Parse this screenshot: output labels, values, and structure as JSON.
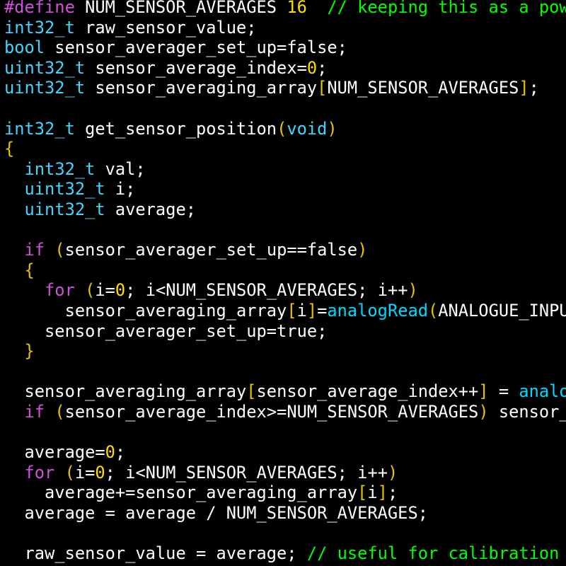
{
  "colors": {
    "background": "#000000",
    "default": "#ffffff",
    "preprocessor": "#d050d8",
    "keyword": "#d050d8",
    "type": "#42d6ff",
    "number": "#ffdd00",
    "comment": "#00ff00",
    "punct": "#e6c300",
    "function": "#00d8ff"
  },
  "lines": [
    [
      [
        "preprocessor",
        "#define"
      ],
      [
        "default",
        " NUM_SENSOR_AVERAGES "
      ],
      [
        "number",
        "16"
      ],
      [
        "default",
        "  "
      ],
      [
        "comment",
        "// keeping this as a pow"
      ]
    ],
    [
      [
        "type",
        "int32_t"
      ],
      [
        "default",
        " raw_sensor_value;"
      ]
    ],
    [
      [
        "type",
        "bool"
      ],
      [
        "default",
        " sensor_averager_set_up=false;"
      ]
    ],
    [
      [
        "type",
        "uint32_t"
      ],
      [
        "default",
        " sensor_average_index="
      ],
      [
        "number",
        "0"
      ],
      [
        "default",
        ";"
      ]
    ],
    [
      [
        "type",
        "uint32_t"
      ],
      [
        "default",
        " sensor_averaging_array"
      ],
      [
        "punct",
        "["
      ],
      [
        "default",
        "NUM_SENSOR_AVERAGES"
      ],
      [
        "punct",
        "]"
      ],
      [
        "default",
        ";"
      ]
    ],
    [],
    [
      [
        "type",
        "int32_t"
      ],
      [
        "default",
        " get_sensor_position"
      ],
      [
        "punct",
        "("
      ],
      [
        "type",
        "void"
      ],
      [
        "punct",
        ")"
      ]
    ],
    [
      [
        "punct",
        "{"
      ]
    ],
    [
      [
        "default",
        "  "
      ],
      [
        "type",
        "int32_t"
      ],
      [
        "default",
        " val;"
      ]
    ],
    [
      [
        "default",
        "  "
      ],
      [
        "type",
        "uint32_t"
      ],
      [
        "default",
        " i;"
      ]
    ],
    [
      [
        "default",
        "  "
      ],
      [
        "type",
        "uint32_t"
      ],
      [
        "default",
        " average;"
      ]
    ],
    [],
    [
      [
        "default",
        "  "
      ],
      [
        "keyword",
        "if"
      ],
      [
        "default",
        " "
      ],
      [
        "punct",
        "("
      ],
      [
        "default",
        "sensor_averager_set_up==false"
      ],
      [
        "punct",
        ")"
      ]
    ],
    [
      [
        "default",
        "  "
      ],
      [
        "punct",
        "{"
      ]
    ],
    [
      [
        "default",
        "    "
      ],
      [
        "keyword",
        "for"
      ],
      [
        "default",
        " "
      ],
      [
        "punct",
        "("
      ],
      [
        "default",
        "i="
      ],
      [
        "number",
        "0"
      ],
      [
        "default",
        "; i<NUM_SENSOR_AVERAGES; i++"
      ],
      [
        "punct",
        ")"
      ]
    ],
    [
      [
        "default",
        "      sensor_averaging_array"
      ],
      [
        "punct",
        "["
      ],
      [
        "default",
        "i"
      ],
      [
        "punct",
        "]"
      ],
      [
        "default",
        "="
      ],
      [
        "function",
        "analogRead"
      ],
      [
        "punct",
        "("
      ],
      [
        "default",
        "ANALOGUE_INPU"
      ]
    ],
    [
      [
        "default",
        "    sensor_averager_set_up=true;"
      ]
    ],
    [
      [
        "default",
        "  "
      ],
      [
        "punct",
        "}"
      ]
    ],
    [],
    [
      [
        "default",
        "  sensor_averaging_array"
      ],
      [
        "punct",
        "["
      ],
      [
        "default",
        "sensor_average_index++"
      ],
      [
        "punct",
        "]"
      ],
      [
        "default",
        " = "
      ],
      [
        "function",
        "analo"
      ]
    ],
    [
      [
        "default",
        "  "
      ],
      [
        "keyword",
        "if"
      ],
      [
        "default",
        " "
      ],
      [
        "punct",
        "("
      ],
      [
        "default",
        "sensor_average_index>=NUM_SENSOR_AVERAGES"
      ],
      [
        "punct",
        ")"
      ],
      [
        "default",
        " sensor_"
      ]
    ],
    [],
    [
      [
        "default",
        "  average="
      ],
      [
        "number",
        "0"
      ],
      [
        "default",
        ";"
      ]
    ],
    [
      [
        "default",
        "  "
      ],
      [
        "keyword",
        "for"
      ],
      [
        "default",
        " "
      ],
      [
        "punct",
        "("
      ],
      [
        "default",
        "i="
      ],
      [
        "number",
        "0"
      ],
      [
        "default",
        "; i<NUM_SENSOR_AVERAGES; i++"
      ],
      [
        "punct",
        ")"
      ]
    ],
    [
      [
        "default",
        "    average+=sensor_averaging_array"
      ],
      [
        "punct",
        "["
      ],
      [
        "default",
        "i"
      ],
      [
        "punct",
        "]"
      ],
      [
        "default",
        ";"
      ]
    ],
    [
      [
        "default",
        "  average = average / NUM_SENSOR_AVERAGES;"
      ]
    ],
    [],
    [
      [
        "default",
        "  raw_sensor_value = average; "
      ],
      [
        "comment",
        "// useful for calibration"
      ]
    ]
  ]
}
